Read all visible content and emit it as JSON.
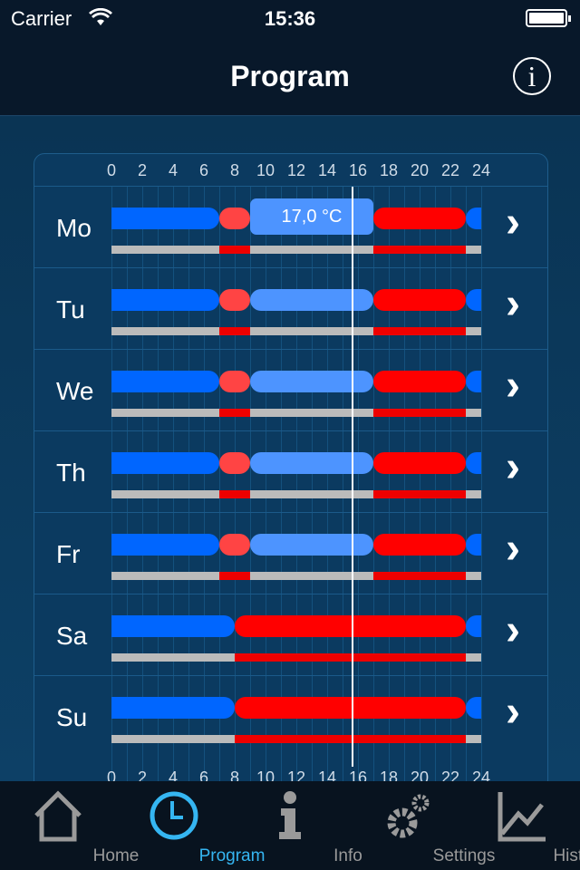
{
  "status": {
    "carrier": "Carrier",
    "time": "15:36"
  },
  "nav": {
    "title": "Program",
    "info_icon": "i"
  },
  "axis": {
    "ticks": [
      "0",
      "2",
      "4",
      "6",
      "8",
      "10",
      "12",
      "14",
      "16",
      "18",
      "20",
      "22",
      "24"
    ]
  },
  "colors": {
    "eco": "#0066ff",
    "comfort_low": "#ff4444",
    "mid": "#4d94ff",
    "comfort": "#ff0000",
    "bar_off": "#bbbbbb",
    "bar_on": "#ee0000"
  },
  "current_time_hours": 15.6,
  "selected_label": "17,0 °C",
  "days": [
    {
      "name": "Mo",
      "segments": [
        [
          0,
          7,
          "eco"
        ],
        [
          7,
          9,
          "comfort_low"
        ],
        [
          9,
          17,
          "mid"
        ],
        [
          17,
          23,
          "comfort"
        ],
        [
          23,
          24,
          "eco"
        ]
      ],
      "selected": true
    },
    {
      "name": "Tu",
      "segments": [
        [
          0,
          7,
          "eco"
        ],
        [
          7,
          9,
          "comfort_low"
        ],
        [
          9,
          17,
          "mid"
        ],
        [
          17,
          23,
          "comfort"
        ],
        [
          23,
          24,
          "eco"
        ]
      ]
    },
    {
      "name": "We",
      "segments": [
        [
          0,
          7,
          "eco"
        ],
        [
          7,
          9,
          "comfort_low"
        ],
        [
          9,
          17,
          "mid"
        ],
        [
          17,
          23,
          "comfort"
        ],
        [
          23,
          24,
          "eco"
        ]
      ]
    },
    {
      "name": "Th",
      "segments": [
        [
          0,
          7,
          "eco"
        ],
        [
          7,
          9,
          "comfort_low"
        ],
        [
          9,
          17,
          "mid"
        ],
        [
          17,
          23,
          "comfort"
        ],
        [
          23,
          24,
          "eco"
        ]
      ]
    },
    {
      "name": "Fr",
      "segments": [
        [
          0,
          7,
          "eco"
        ],
        [
          7,
          9,
          "comfort_low"
        ],
        [
          9,
          17,
          "mid"
        ],
        [
          17,
          23,
          "comfort"
        ],
        [
          23,
          24,
          "eco"
        ]
      ]
    },
    {
      "name": "Sa",
      "segments": [
        [
          0,
          8,
          "eco"
        ],
        [
          8,
          23,
          "comfort"
        ],
        [
          23,
          24,
          "eco"
        ]
      ]
    },
    {
      "name": "Su",
      "segments": [
        [
          0,
          8,
          "eco"
        ],
        [
          8,
          23,
          "comfort"
        ],
        [
          23,
          24,
          "eco"
        ]
      ]
    }
  ],
  "tabs": [
    {
      "label": "Home",
      "icon": "house-icon"
    },
    {
      "label": "Program",
      "icon": "clock-icon",
      "active": true
    },
    {
      "label": "Info",
      "icon": "info-icon"
    },
    {
      "label": "Settings",
      "icon": "gears-icon"
    },
    {
      "label": "History",
      "icon": "chart-icon"
    }
  ]
}
